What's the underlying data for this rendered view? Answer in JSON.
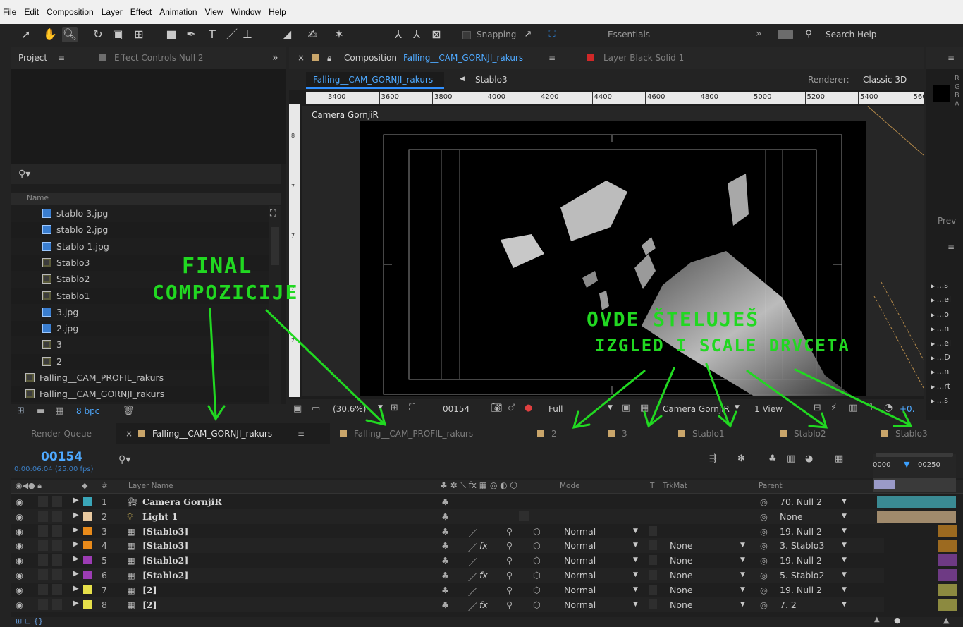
{
  "menu": [
    "File",
    "Edit",
    "Composition",
    "Layer",
    "Effect",
    "Animation",
    "View",
    "Window",
    "Help"
  ],
  "toolbar": {
    "snapping": "Snapping",
    "workspace": "Essentials",
    "search": "Search Help",
    "more": "»"
  },
  "project": {
    "tab": "Project",
    "tab2": "Effect Controls Null 2",
    "column_name": "Name",
    "items": [
      {
        "name": "stablo 3.jpg",
        "type": "image",
        "indent": true
      },
      {
        "name": "stablo 2.jpg",
        "type": "image",
        "indent": true
      },
      {
        "name": "Stablo 1.jpg",
        "type": "image",
        "indent": true
      },
      {
        "name": "Stablo3",
        "type": "comp",
        "indent": true
      },
      {
        "name": "Stablo2",
        "type": "comp",
        "indent": true
      },
      {
        "name": "Stablo1",
        "type": "comp",
        "indent": true
      },
      {
        "name": "3.jpg",
        "type": "image",
        "indent": true
      },
      {
        "name": "2.jpg",
        "type": "image",
        "indent": true
      },
      {
        "name": "3",
        "type": "comp",
        "indent": true
      },
      {
        "name": "2",
        "type": "comp",
        "indent": true
      },
      {
        "name": "Falling__CAM_PROFIL_rakurs",
        "type": "comp",
        "indent": false
      },
      {
        "name": "Falling__CAM_GORNJI_rakurs",
        "type": "comp",
        "indent": false
      }
    ],
    "bpc": "8 bpc"
  },
  "composition": {
    "tab_prefix": "Composition",
    "tab_name": "Falling__CAM_GORNJI_rakurs",
    "tab2": "Layer Black Solid 1",
    "breadcrumb1": "Falling__CAM_GORNJI_rakurs",
    "breadcrumb2": "Stablo3",
    "renderer_label": "Renderer:",
    "renderer_value": "Classic 3D",
    "ruler": [
      "3400",
      "3600",
      "3800",
      "4000",
      "4200",
      "4400",
      "4600",
      "4800",
      "5000",
      "5200",
      "5400",
      "560"
    ],
    "camera_label": "Camera GornjiR",
    "zoom": "(30.6%)",
    "frame": "00154",
    "quality": "Full",
    "view_camera": "Camera GornjiR",
    "views": "1 View",
    "exposure": "+0."
  },
  "right_panel": {
    "channels": [
      "R",
      "G",
      "B",
      "A"
    ],
    "prev": "Prev",
    "items": [
      "...s",
      "...el",
      "...o",
      "...n",
      "...el",
      "...D",
      "...n",
      "...rt",
      "...s"
    ]
  },
  "timeline": {
    "tabs": [
      {
        "label": "Render Queue",
        "color": ""
      },
      {
        "label": "Falling__CAM_GORNJI_rakurs",
        "color": "#c9a56a",
        "active": true
      },
      {
        "label": "Falling__CAM_PROFIL_rakurs",
        "color": "#c9a56a"
      },
      {
        "label": "2",
        "color": "#c9a56a"
      },
      {
        "label": "3",
        "color": "#c9a56a"
      },
      {
        "label": "Stablo1",
        "color": "#c9a56a"
      },
      {
        "label": "Stablo2",
        "color": "#c9a56a"
      },
      {
        "label": "Stablo3",
        "color": "#c9a56a"
      }
    ],
    "timecode": "00154",
    "timecode_sub": "0:00:06:04 (25.00 fps)",
    "ruler_start": "0000",
    "ruler_mark": "00250",
    "headers": {
      "hash": "#",
      "layer_name": "Layer Name",
      "mode": "Mode",
      "t": "T",
      "trkmat": "TrkMat",
      "parent": "Parent"
    },
    "layers": [
      {
        "num": "1",
        "name": "Camera GornjiR",
        "color": "#3aa6b9",
        "kind": "camera",
        "mode": "",
        "trkmat": "",
        "parent": "70. Null 2",
        "fx": false,
        "bar": "#3a8a93"
      },
      {
        "num": "2",
        "name": "Light 1",
        "color": "#e8c9a0",
        "kind": "light",
        "mode": "",
        "trkmat": "",
        "parent": "None",
        "fx": false,
        "bar": "#a08a6c"
      },
      {
        "num": "3",
        "name": "[Stablo3]",
        "color": "#e88a1a",
        "kind": "comp",
        "mode": "Normal",
        "trkmat": "",
        "parent": "19. Null 2",
        "fx": false,
        "bar": "#9c6a20"
      },
      {
        "num": "4",
        "name": "[Stablo3]",
        "color": "#e88a1a",
        "kind": "comp",
        "mode": "Normal",
        "trkmat": "None",
        "parent": "3. Stablo3",
        "fx": true,
        "bar": "#9c6a20"
      },
      {
        "num": "5",
        "name": "[Stablo2]",
        "color": "#9c3cb4",
        "kind": "comp",
        "mode": "Normal",
        "trkmat": "None",
        "parent": "19. Null 2",
        "fx": false,
        "bar": "#6e3a84"
      },
      {
        "num": "6",
        "name": "[Stablo2]",
        "color": "#9c3cb4",
        "kind": "comp",
        "mode": "Normal",
        "trkmat": "None",
        "parent": "5. Stablo2",
        "fx": true,
        "bar": "#6e3a84"
      },
      {
        "num": "7",
        "name": "[2]",
        "color": "#e6e04a",
        "kind": "comp",
        "mode": "Normal",
        "trkmat": "None",
        "parent": "19. Null 2",
        "fx": false,
        "bar": "#8c8a40"
      },
      {
        "num": "8",
        "name": "[2]",
        "color": "#e6e04a",
        "kind": "comp",
        "mode": "Normal",
        "trkmat": "None",
        "parent": "7. 2",
        "fx": true,
        "bar": "#8c8a40"
      }
    ]
  },
  "annotations": {
    "a1": "FINAL",
    "a2": "COMPOZICIJE",
    "a3": "OVDE ŠTELUJEŠ",
    "a4": "IZGLED I SCALE DRVCETA"
  }
}
